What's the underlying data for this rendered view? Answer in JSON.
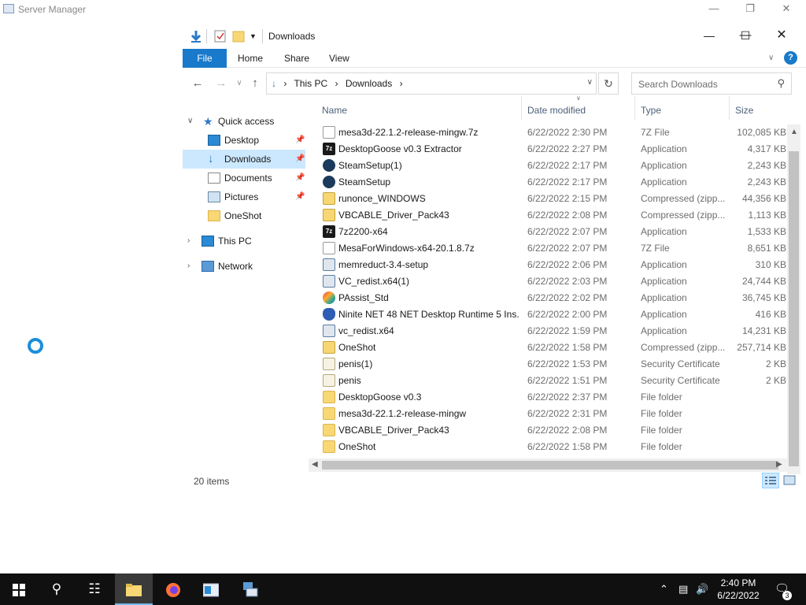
{
  "background_window": {
    "title": "Server Manager"
  },
  "explorer": {
    "title": "Downloads",
    "ribbon": {
      "file": "File",
      "tabs": [
        "Home",
        "Share",
        "View"
      ],
      "help": "?"
    },
    "address": {
      "crumbs": [
        "This PC",
        "Downloads"
      ]
    },
    "search": {
      "placeholder": "Search Downloads"
    },
    "nav": {
      "quick_access": "Quick access",
      "pinned": [
        {
          "label": "Desktop",
          "pinned": true
        },
        {
          "label": "Downloads",
          "pinned": true,
          "selected": true
        },
        {
          "label": "Documents",
          "pinned": true
        },
        {
          "label": "Pictures",
          "pinned": true
        },
        {
          "label": "OneShot",
          "pinned": false
        }
      ],
      "this_pc": "This PC",
      "network": "Network"
    },
    "columns": {
      "name": "Name",
      "date": "Date modified",
      "type": "Type",
      "size": "Size"
    },
    "files": [
      {
        "name": "mesa3d-22.1.2-release-mingw.7z",
        "date": "6/22/2022 2:30 PM",
        "type": "7Z File",
        "size": "102,085 KB",
        "icon": "file"
      },
      {
        "name": "DesktopGoose v0.3 Extractor",
        "date": "6/22/2022 2:27 PM",
        "type": "Application",
        "size": "4,317 KB",
        "icon": "7z"
      },
      {
        "name": "SteamSetup(1)",
        "date": "6/22/2022 2:17 PM",
        "type": "Application",
        "size": "2,243 KB",
        "icon": "steam"
      },
      {
        "name": "SteamSetup",
        "date": "6/22/2022 2:17 PM",
        "type": "Application",
        "size": "2,243 KB",
        "icon": "steam"
      },
      {
        "name": "runonce_WINDOWS",
        "date": "6/22/2022 2:15 PM",
        "type": "Compressed (zipp...",
        "size": "44,356 KB",
        "icon": "zip"
      },
      {
        "name": "VBCABLE_Driver_Pack43",
        "date": "6/22/2022 2:08 PM",
        "type": "Compressed (zipp...",
        "size": "1,113 KB",
        "icon": "zip"
      },
      {
        "name": "7z2200-x64",
        "date": "6/22/2022 2:07 PM",
        "type": "Application",
        "size": "1,533 KB",
        "icon": "7z"
      },
      {
        "name": "MesaForWindows-x64-20.1.8.7z",
        "date": "6/22/2022 2:07 PM",
        "type": "7Z File",
        "size": "8,651 KB",
        "icon": "file"
      },
      {
        "name": "memreduct-3.4-setup",
        "date": "6/22/2022 2:06 PM",
        "type": "Application",
        "size": "310 KB",
        "icon": "app"
      },
      {
        "name": "VC_redist.x64(1)",
        "date": "6/22/2022 2:03 PM",
        "type": "Application",
        "size": "24,744 KB",
        "icon": "app"
      },
      {
        "name": "PAssist_Std",
        "date": "6/22/2022 2:02 PM",
        "type": "Application",
        "size": "36,745 KB",
        "icon": "color"
      },
      {
        "name": "Ninite NET 48 NET Desktop Runtime 5 Ins...",
        "date": "6/22/2022 2:00 PM",
        "type": "Application",
        "size": "416 KB",
        "icon": "ninite"
      },
      {
        "name": "vc_redist.x64",
        "date": "6/22/2022 1:59 PM",
        "type": "Application",
        "size": "14,231 KB",
        "icon": "app"
      },
      {
        "name": "OneShot",
        "date": "6/22/2022 1:58 PM",
        "type": "Compressed (zipp...",
        "size": "257,714 KB",
        "icon": "zip"
      },
      {
        "name": "penis(1)",
        "date": "6/22/2022 1:53 PM",
        "type": "Security Certificate",
        "size": "2 KB",
        "icon": "cert"
      },
      {
        "name": "penis",
        "date": "6/22/2022 1:51 PM",
        "type": "Security Certificate",
        "size": "2 KB",
        "icon": "cert"
      },
      {
        "name": "DesktopGoose v0.3",
        "date": "6/22/2022 2:37 PM",
        "type": "File folder",
        "size": "",
        "icon": "folder"
      },
      {
        "name": "mesa3d-22.1.2-release-mingw",
        "date": "6/22/2022 2:31 PM",
        "type": "File folder",
        "size": "",
        "icon": "folder"
      },
      {
        "name": "VBCABLE_Driver_Pack43",
        "date": "6/22/2022 2:08 PM",
        "type": "File folder",
        "size": "",
        "icon": "folder"
      },
      {
        "name": "OneShot",
        "date": "6/22/2022 1:58 PM",
        "type": "File folder",
        "size": "",
        "icon": "folder"
      }
    ],
    "status": {
      "count": "20 items"
    }
  },
  "taskbar": {
    "clock_time": "2:40 PM",
    "clock_date": "6/22/2022",
    "notification_count": "3"
  },
  "colors": {
    "accent": "#1979ca",
    "selection": "#cce8ff",
    "taskbar": "#101010"
  }
}
